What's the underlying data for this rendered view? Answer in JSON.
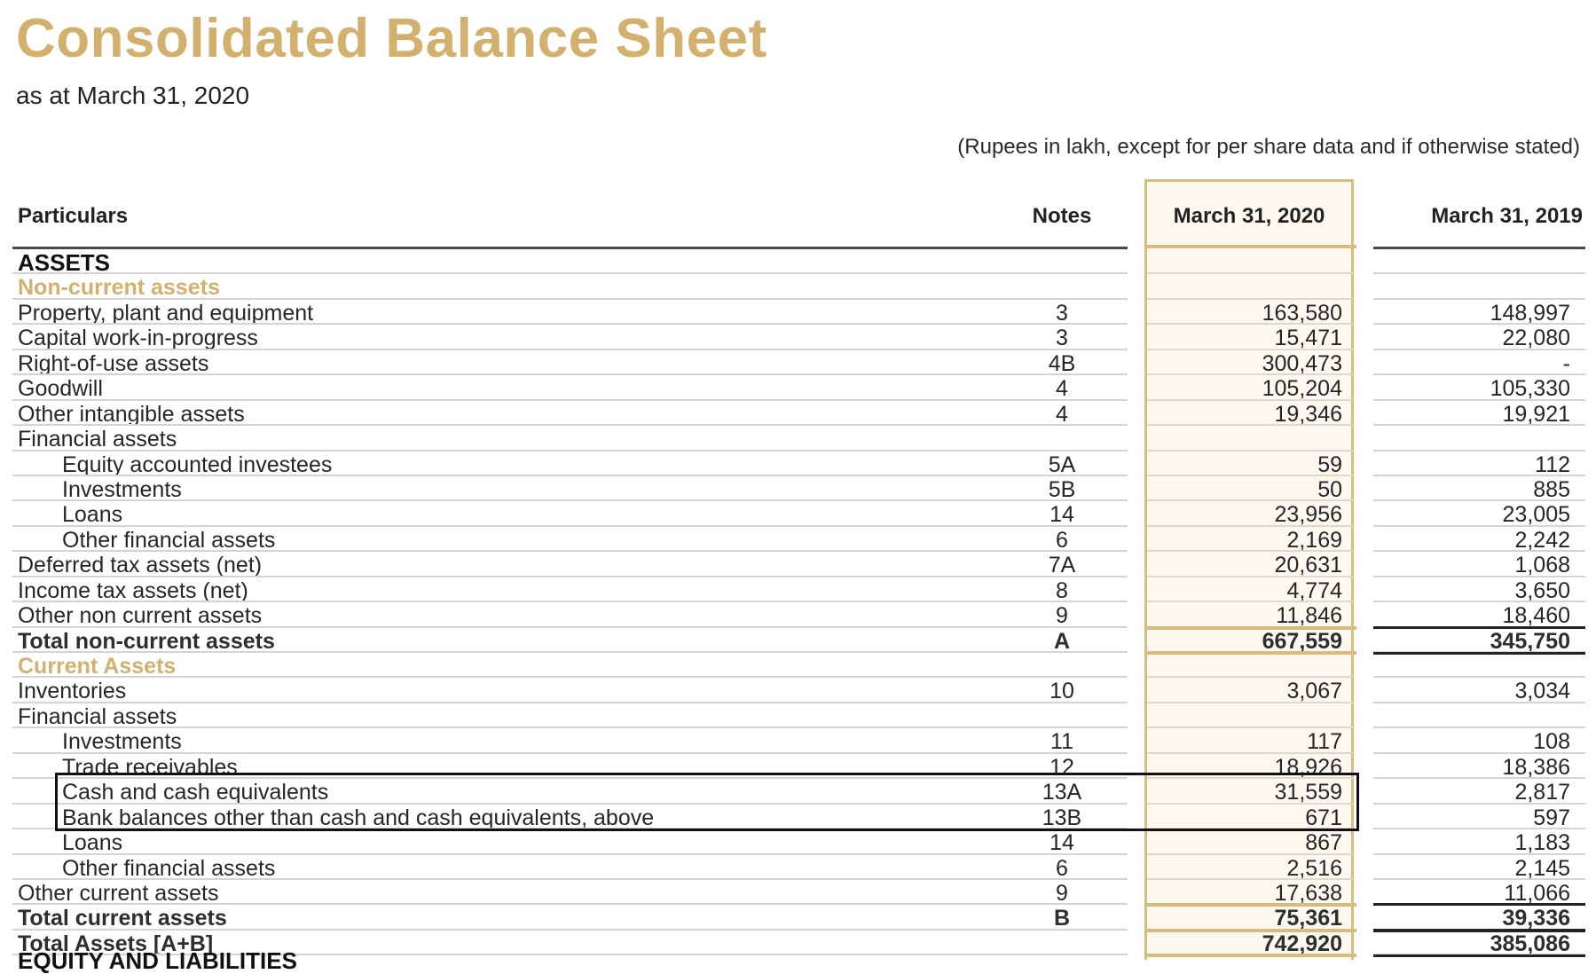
{
  "document": {
    "title": "Consolidated Balance Sheet",
    "subtitle": "as at March 31, 2020",
    "unit_note": "(Rupees in lakh, except for per share data and if otherwise stated)",
    "colors": {
      "accent_gold": "#d3b06e",
      "highlight_fill": "#fbf8ef",
      "highlight_border": "#d9bb7f"
    }
  },
  "table": {
    "headers": {
      "particulars": "Particulars",
      "notes": "Notes",
      "current_year": "March 31, 2020",
      "prior_year": "March 31, 2019"
    },
    "rows": [
      {
        "type": "heading",
        "label": "ASSETS",
        "note": "",
        "v2020": "",
        "v2019": ""
      },
      {
        "type": "section",
        "label": "Non-current assets",
        "note": "",
        "v2020": "",
        "v2019": ""
      },
      {
        "type": "item",
        "label": "Property, plant and equipment",
        "note": "3",
        "v2020": "163,580",
        "v2019": "148,997"
      },
      {
        "type": "item",
        "label": "Capital work-in-progress",
        "note": "3",
        "v2020": "15,471",
        "v2019": "22,080"
      },
      {
        "type": "item",
        "label": "Right-of-use assets",
        "note": "4B",
        "v2020": "300,473",
        "v2019": "-"
      },
      {
        "type": "item",
        "label": "Goodwill",
        "note": "4",
        "v2020": "105,204",
        "v2019": "105,330"
      },
      {
        "type": "item",
        "label": "Other intangible assets",
        "note": "4",
        "v2020": "19,346",
        "v2019": "19,921"
      },
      {
        "type": "item",
        "label": "Financial assets",
        "note": "",
        "v2020": "",
        "v2019": ""
      },
      {
        "type": "sub",
        "label": "Equity accounted investees",
        "note": "5A",
        "v2020": "59",
        "v2019": "112"
      },
      {
        "type": "sub",
        "label": "Investments",
        "note": "5B",
        "v2020": "50",
        "v2019": "885"
      },
      {
        "type": "sub",
        "label": "Loans",
        "note": "14",
        "v2020": "23,956",
        "v2019": "23,005"
      },
      {
        "type": "sub",
        "label": "Other financial assets",
        "note": "6",
        "v2020": "2,169",
        "v2019": "2,242"
      },
      {
        "type": "item",
        "label": "Deferred tax assets (net)",
        "note": "7A",
        "v2020": "20,631",
        "v2019": "1,068"
      },
      {
        "type": "item",
        "label": "Income tax assets (net)",
        "note": "8",
        "v2020": "4,774",
        "v2019": "3,650"
      },
      {
        "type": "item",
        "label": "Other non current assets",
        "note": "9",
        "v2020": "11,846",
        "v2019": "18,460"
      },
      {
        "type": "total",
        "label": "Total non-current assets",
        "note": "A",
        "v2020": "667,559",
        "v2019": "345,750"
      },
      {
        "type": "section",
        "label": "Current Assets",
        "note": "",
        "v2020": "",
        "v2019": ""
      },
      {
        "type": "item",
        "label": "Inventories",
        "note": "10",
        "v2020": "3,067",
        "v2019": "3,034"
      },
      {
        "type": "item",
        "label": "Financial assets",
        "note": "",
        "v2020": "",
        "v2019": ""
      },
      {
        "type": "sub",
        "label": "Investments",
        "note": "11",
        "v2020": "117",
        "v2019": "108"
      },
      {
        "type": "sub",
        "label": "Trade receivables",
        "note": "12",
        "v2020": "18,926",
        "v2019": "18,386"
      },
      {
        "type": "sub",
        "label": "Cash and cash equivalents",
        "note": "13A",
        "v2020": "31,559",
        "v2019": "2,817"
      },
      {
        "type": "sub",
        "label": "Bank balances other than cash and cash equivalents, above",
        "note": "13B",
        "v2020": "671",
        "v2019": "597"
      },
      {
        "type": "sub",
        "label": "Loans",
        "note": "14",
        "v2020": "867",
        "v2019": "1,183"
      },
      {
        "type": "sub",
        "label": "Other financial assets",
        "note": "6",
        "v2020": "2,516",
        "v2019": "2,145"
      },
      {
        "type": "item",
        "label": "Other current assets",
        "note": "9",
        "v2020": "17,638",
        "v2019": "11,066"
      },
      {
        "type": "total",
        "label": "Total current assets",
        "note": "B",
        "v2020": "75,361",
        "v2019": "39,336"
      },
      {
        "type": "total",
        "label": "Total Assets [A+B]",
        "note": "",
        "v2020": "742,920",
        "v2019": "385,086"
      }
    ],
    "cutoff_label": "EQUITY AND LIABILITIES"
  }
}
